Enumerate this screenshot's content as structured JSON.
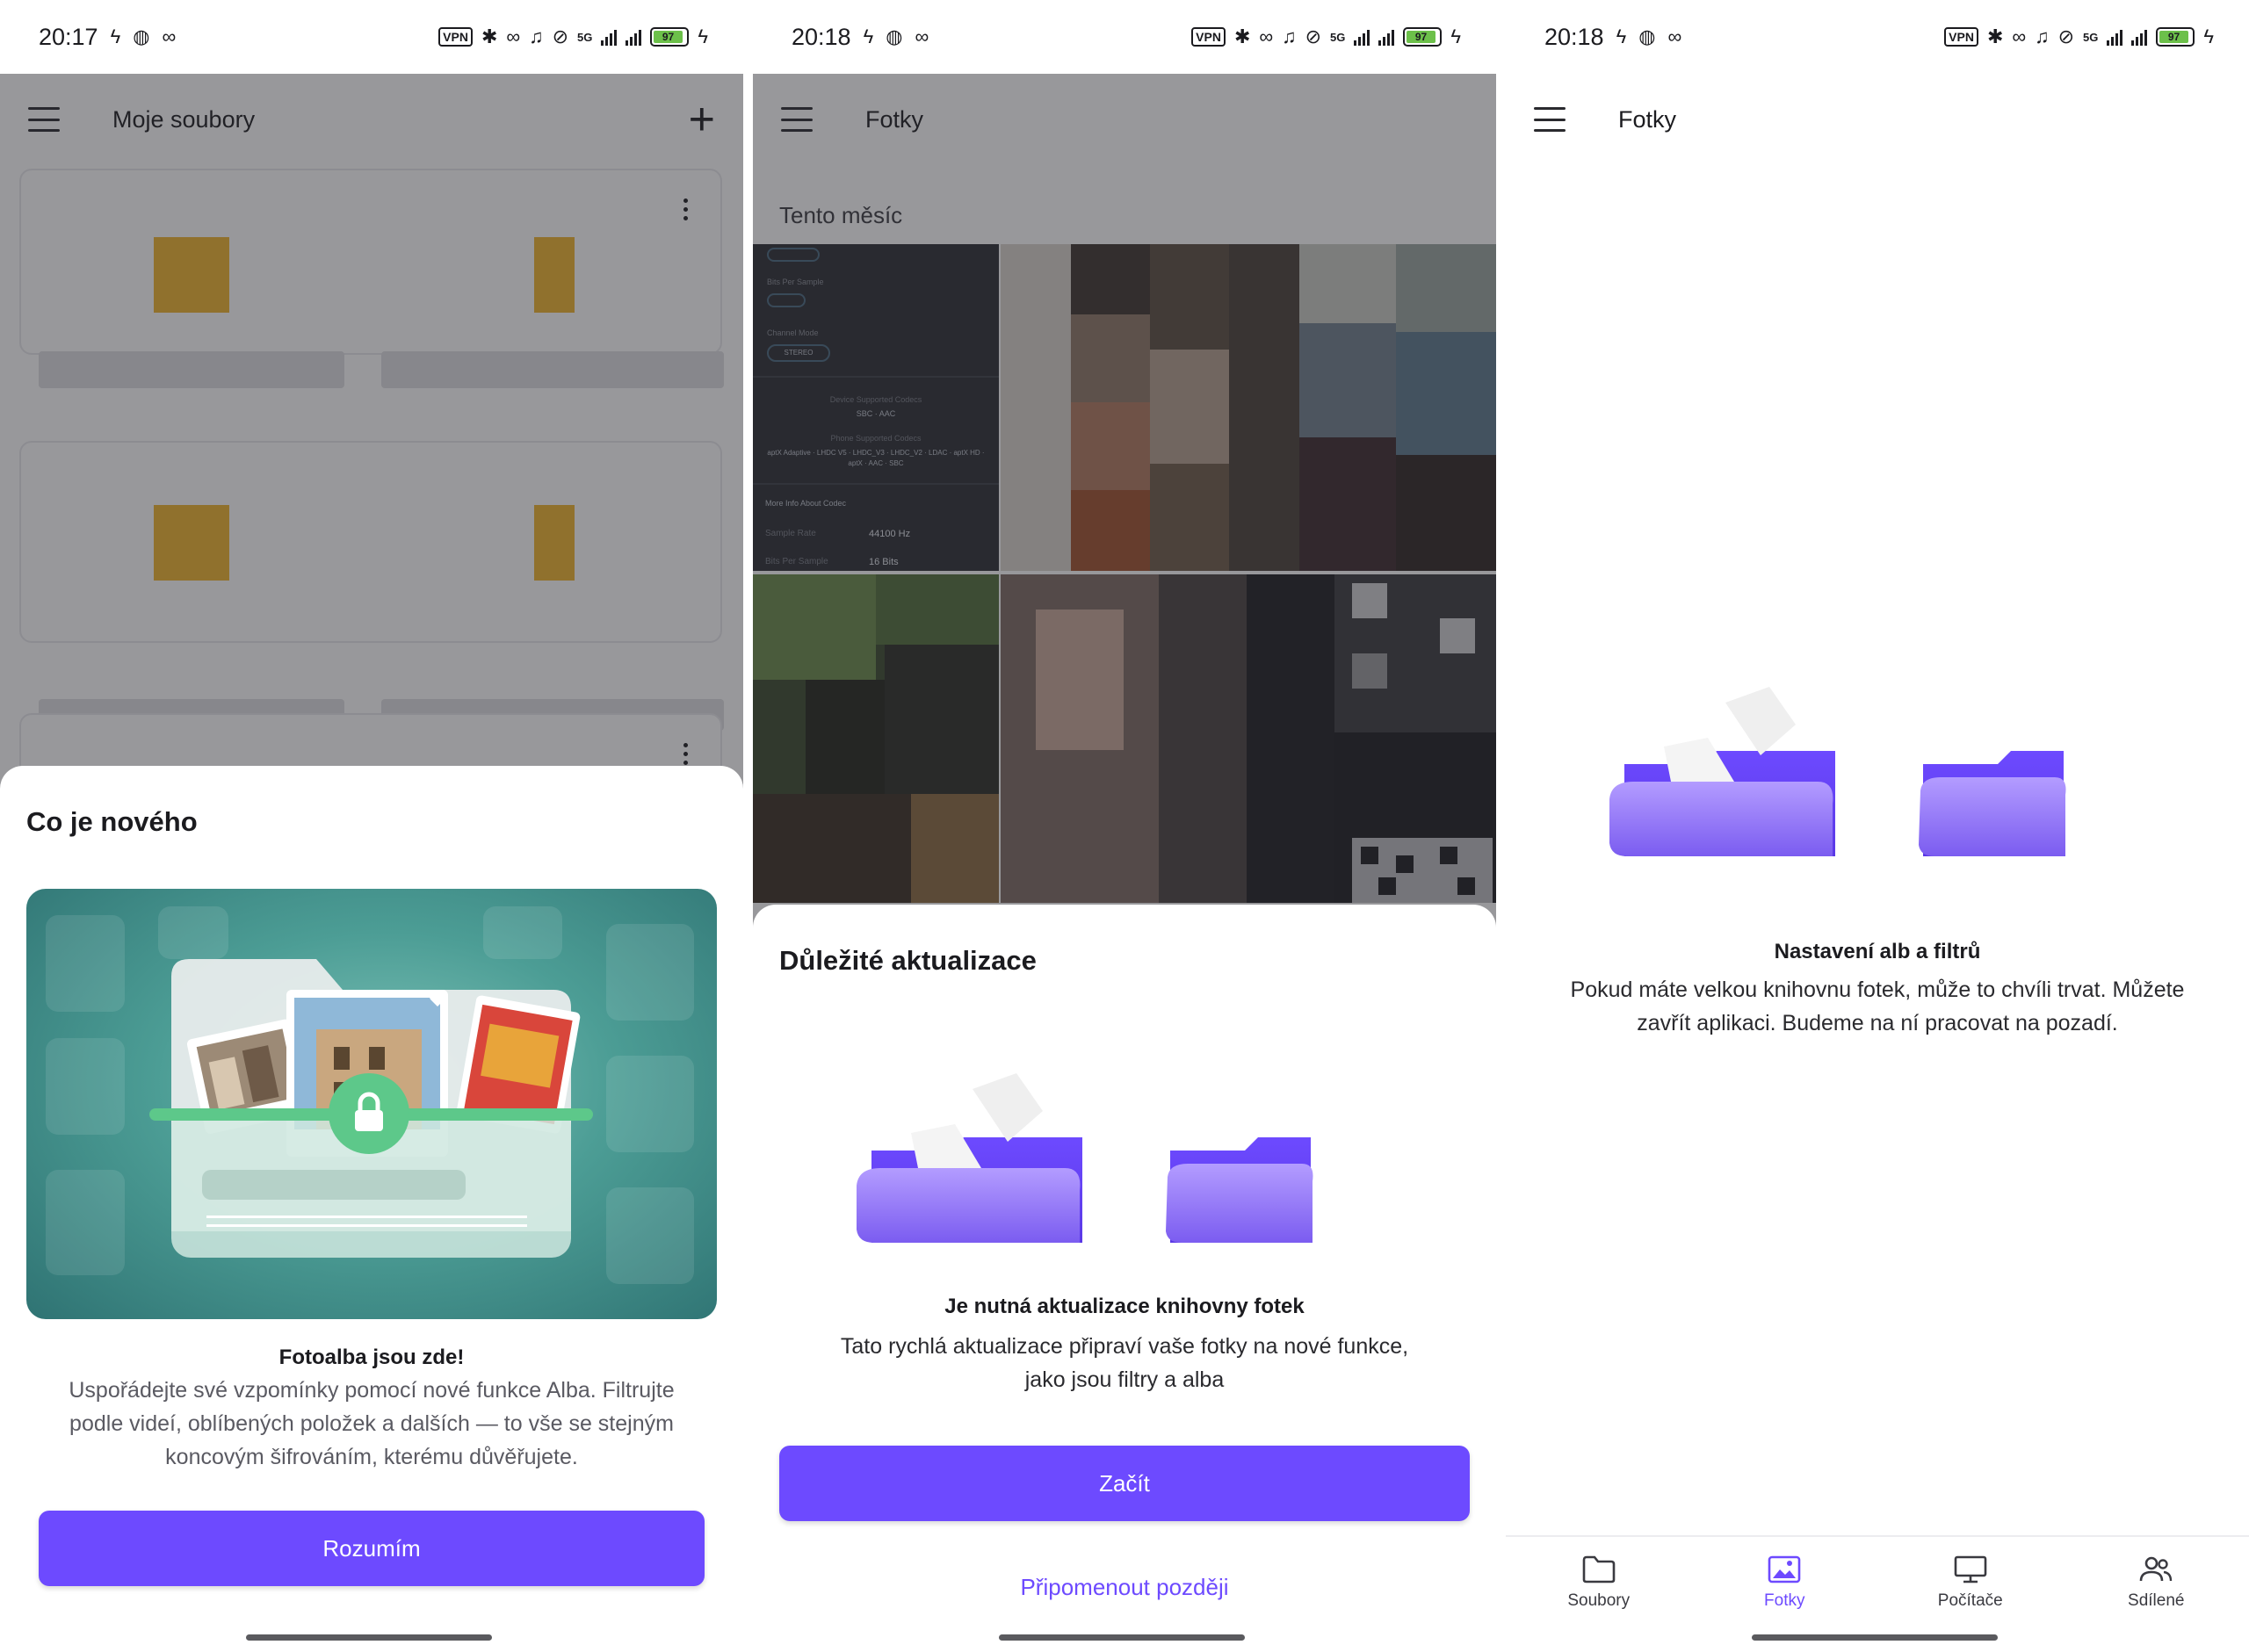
{
  "status_bars": [
    {
      "time": "20:17",
      "battery": "97"
    },
    {
      "time": "20:18",
      "battery": "97"
    },
    {
      "time": "20:18",
      "battery": "97"
    }
  ],
  "status_labels": {
    "vpn": "VPN",
    "network": "5G"
  },
  "phone1": {
    "appbar_title": "Moje soubory",
    "sheet": {
      "title": "Co je nového",
      "headline": "Fotoalba jsou zde!",
      "body": "Uspořádejte své vzpomínky pomocí nové funkce Alba. Filtrujte podle videí, oblíbených položek a dalších — to vše se stejným koncovým šifrováním, kterému důvěřujete.",
      "button": "Rozumím"
    }
  },
  "phone2": {
    "appbar_title": "Fotky",
    "section_label": "Tento měsíc",
    "screenshot_thumb": {
      "sample_rate_label": "Sample Rate",
      "sample_rate_value": "44100 Hz",
      "bits_label": "Bits Per Sample",
      "bits_value": "16 Bits",
      "more_info": "More Info About Codec",
      "device_codecs": "Device Supported Codecs",
      "device_codecs_value": "SBC · AAC",
      "phone_codecs": "Phone Supported Codecs",
      "phone_codecs_value": "aptX Adaptive · LHDC V5 · LHDC_V3 · LHDC_V2 · LDAC · aptX HD · aptX · AAC · SBC",
      "channel_mode": "Channel Mode",
      "stereo": "STEREO"
    },
    "sheet": {
      "title": "Důležité aktualizace",
      "headline": "Je nutná aktualizace knihovny fotek",
      "body": "Tato rychlá aktualizace připraví vaše fotky na nové funkce, jako jsou filtry a alba",
      "primary_button": "Začít",
      "secondary_button": "Připomenout později"
    }
  },
  "phone3": {
    "appbar_title": "Fotky",
    "headline": "Nastavení alb a filtrů",
    "body": "Pokud máte velkou knihovnu fotek, může to chvíli trvat. Můžete zavřít aplikaci. Budeme na ní pracovat na pozadí.",
    "nav": [
      {
        "label": "Soubory",
        "icon": "folder-icon",
        "active": false
      },
      {
        "label": "Fotky",
        "icon": "photo-icon",
        "active": true
      },
      {
        "label": "Počítače",
        "icon": "monitor-icon",
        "active": false
      },
      {
        "label": "Sdílené",
        "icon": "people-icon",
        "active": false
      }
    ]
  },
  "colors": {
    "accent": "#6d4aff",
    "folder_yellow": "#f0b42d",
    "folder_purple": "#8b6cf5",
    "promo_teal": "#4c9d95",
    "lock_green": "#5dc88a"
  }
}
